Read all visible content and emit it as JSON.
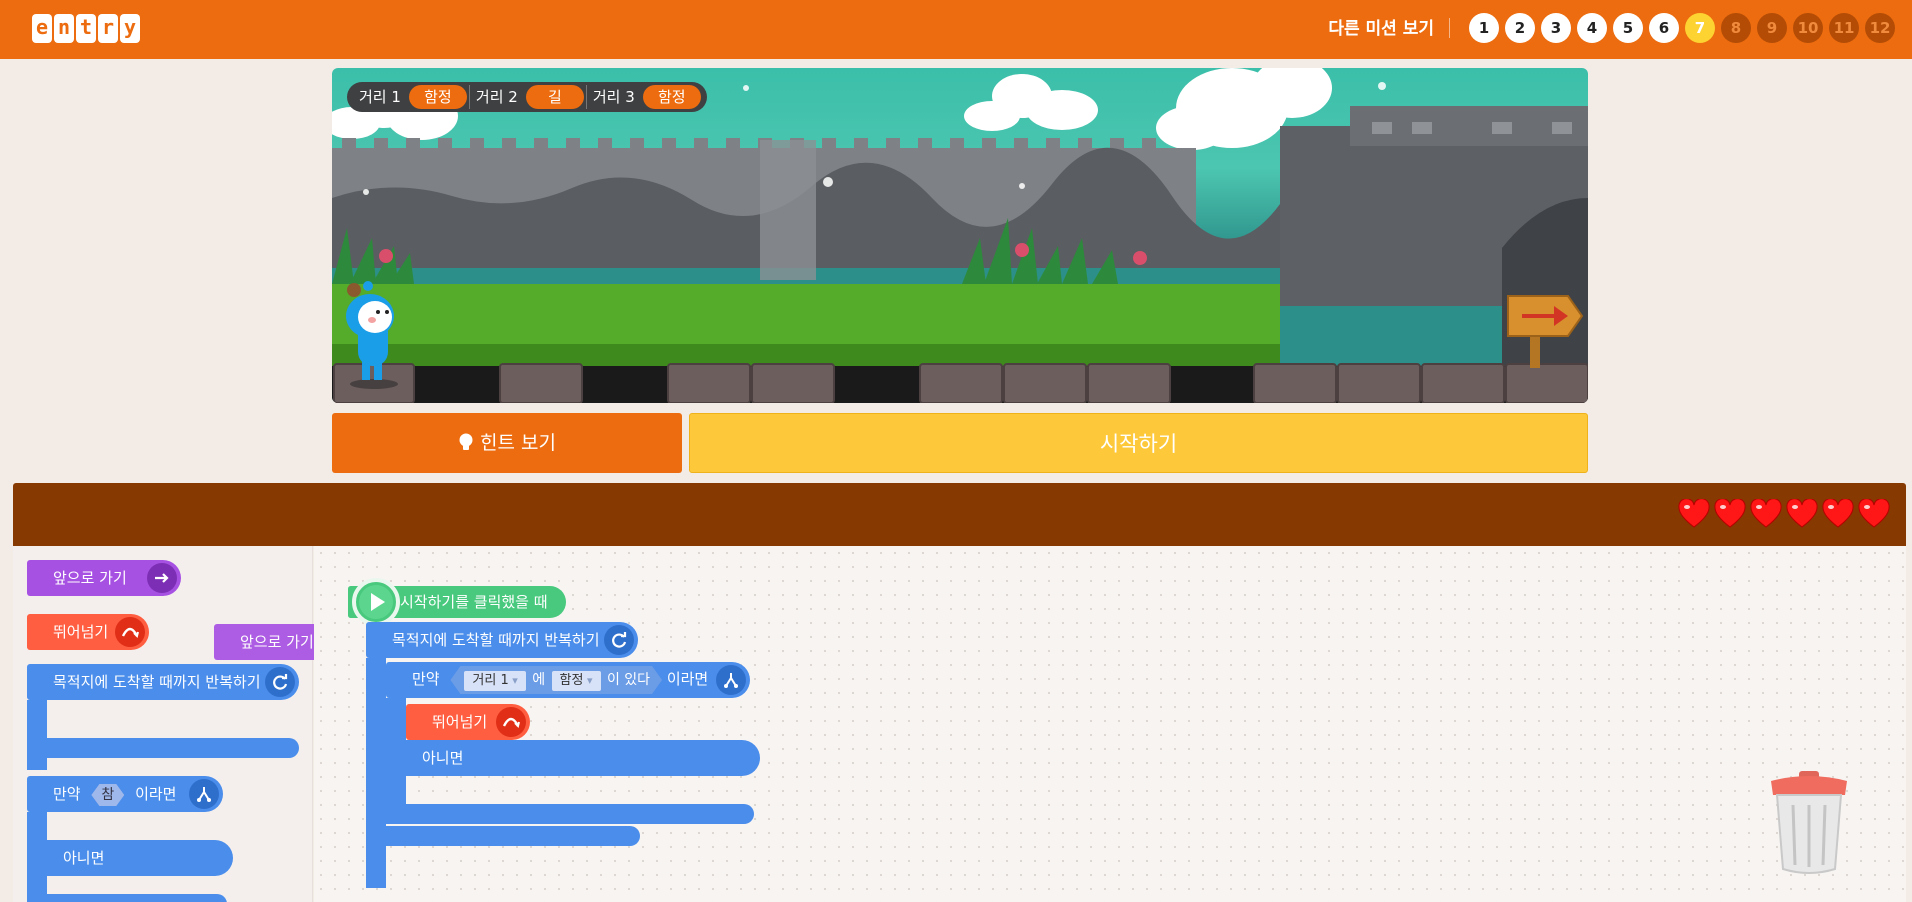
{
  "header": {
    "logo_letters": [
      "e",
      "n",
      "t",
      "r",
      "y"
    ],
    "other_missions_label": "다른 미션 보기",
    "missions": [
      {
        "label": "1",
        "state": "done"
      },
      {
        "label": "2",
        "state": "done"
      },
      {
        "label": "3",
        "state": "done"
      },
      {
        "label": "4",
        "state": "done"
      },
      {
        "label": "5",
        "state": "done"
      },
      {
        "label": "6",
        "state": "done"
      },
      {
        "label": "7",
        "state": "current"
      },
      {
        "label": "8",
        "state": "locked"
      },
      {
        "label": "9",
        "state": "locked"
      },
      {
        "label": "10",
        "state": "locked"
      },
      {
        "label": "11",
        "state": "locked"
      },
      {
        "label": "12",
        "state": "locked"
      }
    ]
  },
  "stage": {
    "distances": [
      {
        "label": "거리 1",
        "value": "함정"
      },
      {
        "label": "거리 2",
        "value": "길"
      },
      {
        "label": "거리 3",
        "value": "함정"
      }
    ]
  },
  "buttons": {
    "hint": "힌트 보기",
    "start": "시작하기"
  },
  "workspace": {
    "hearts": 6,
    "palette": {
      "forward": "앞으로 가기",
      "jump": "뛰어넘기",
      "repeat": "목적지에 도착할 때까지 반복하기",
      "if": "만약",
      "true_value": "참",
      "then": "이라면",
      "else": "아니면"
    },
    "dragging_block": "앞으로 가기",
    "script": {
      "when_start": "시작하기를 클릭했을 때",
      "repeat": "목적지에 도착할 때까지 반복하기",
      "if": "만약",
      "distance_select": "거리 1",
      "particle": "에",
      "value_select": "함정",
      "exists": "이 있다",
      "then": "이라면",
      "jump": "뛰어넘기",
      "else": "아니면"
    }
  },
  "colors": {
    "header_orange": "#ec6c0f",
    "start_yellow": "#fdc93a",
    "workspace_brown": "#863900",
    "move_purple": "#a751e3",
    "jump_red": "#ff5e40",
    "flow_blue": "#4a8deb",
    "event_green": "#48c97d"
  }
}
